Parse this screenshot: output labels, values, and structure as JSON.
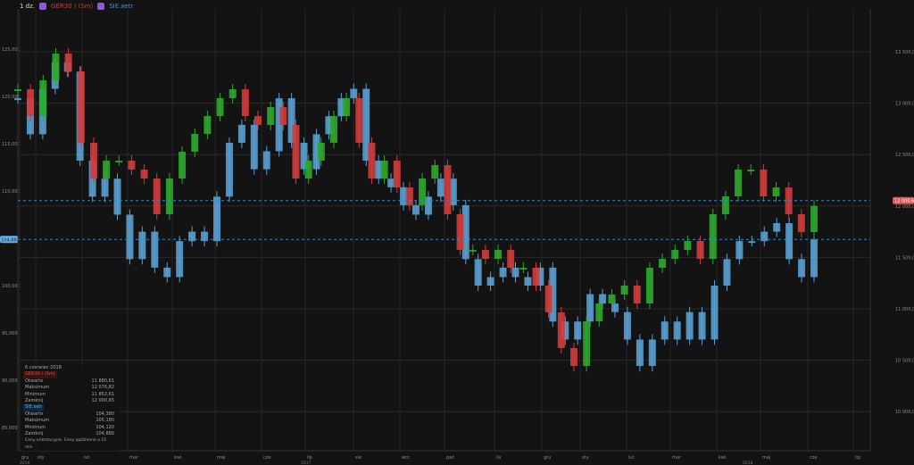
{
  "toolbar": {
    "interval": "1 dz.",
    "symbol1": "GER30 / (Sm)",
    "symbol2": "SIE.xetr",
    "icon": "instrument-icon"
  },
  "legend": {
    "date": "6 czerwiec 2018",
    "s1": {
      "name": "GER30 / (Sm)",
      "rows": [
        [
          "Otwarte",
          "11 880,61"
        ],
        [
          "Maksimum",
          "12 076,82"
        ],
        [
          "Minimum",
          "11 852,61"
        ],
        [
          "Zamknij",
          "12 000,65"
        ]
      ]
    },
    "s2": {
      "name": "SIE.xetr",
      "rows": [
        [
          "Otwarte",
          "104,380"
        ],
        [
          "Maksimum",
          "105,180"
        ],
        [
          "Minimum",
          "104,120"
        ],
        [
          "Zamknij",
          "104,880"
        ]
      ]
    },
    "note": "Ceny orientacyjne. Ceny opóźnione o 15 min"
  },
  "chart_data": {
    "type": "candlestick-overlay",
    "x_range": [
      "2016-12",
      "2018-06-06"
    ],
    "x_ticks": [
      "gru",
      "sty",
      "lut",
      "mar",
      "kwi",
      "maj",
      "cze",
      "lip",
      "sie",
      "wrz",
      "paź",
      "lis",
      "gru",
      "sty",
      "lut",
      "mar",
      "kwi",
      "maj",
      "cze",
      "lip"
    ],
    "year_labels": [
      "2016",
      "2017",
      "2018"
    ],
    "grid": true,
    "colors": {
      "up": "#2ea82e",
      "down": "#d23c3c",
      "s2": "#5aa0d0",
      "bg": "#131313"
    },
    "right_axis": {
      "series": "GER30 / (Sm)",
      "ylim": [
        9500,
        13600
      ],
      "ticks": [
        "13 500,00",
        "13 000,00",
        "12 500,00",
        "12 000,00",
        "11 500,00",
        "11 000,00",
        "10 500,00",
        "10 000,00"
      ],
      "tick_values": [
        13500,
        13000,
        12500,
        12000,
        11500,
        11000,
        10500,
        10000
      ],
      "last": "12 000,65",
      "last_value": 12000.65
    },
    "left_axis": {
      "series": "SIE.xetr",
      "ylim": [
        84,
        126
      ],
      "ticks": [
        "125,000",
        "120,000",
        "115,000",
        "110,000",
        "105,000",
        "100,000",
        "95,000",
        "90,000",
        "85,000"
      ],
      "tick_values": [
        125,
        120,
        115,
        110,
        105,
        100,
        95,
        90,
        85
      ],
      "last": "104,880",
      "last_value": 104.88
    },
    "series": [
      {
        "name": "GER30 / (Sm)",
        "axis": "right",
        "values": [
          13135,
          12875,
          13222,
          13483,
          13309,
          12615,
          12267,
          12441,
          12441,
          12354,
          12267,
          11920,
          12267,
          12528,
          12701,
          12875,
          13049,
          13135,
          12875,
          12788,
          12962,
          12788,
          12267,
          12441,
          12615,
          12875,
          13049,
          12615,
          12267,
          12441,
          12180,
          12007,
          12267,
          12398,
          11920,
          11573,
          11573,
          11486,
          11573,
          11399,
          11399,
          11226,
          10965,
          10618,
          10444,
          10878,
          11052,
          11139,
          11226,
          11052,
          11399,
          11486,
          11573,
          11660,
          11486,
          11920,
          12094,
          12354,
          12354,
          12094,
          12180,
          11920,
          11747,
          12001
        ]
      },
      {
        "name": "SIE.xetr",
        "axis": "left",
        "values": [
          119.8,
          116.0,
          120.8,
          123.6,
          122.6,
          113.2,
          109.4,
          111.3,
          107.5,
          102.8,
          105.7,
          101.9,
          100.9,
          104.7,
          105.7,
          104.7,
          109.4,
          115.1,
          117.0,
          112.3,
          114.2,
          119.8,
          115.1,
          112.3,
          116.0,
          117.9,
          119.8,
          120.8,
          113.2,
          111.3,
          110.4,
          108.5,
          107.5,
          109.4,
          111.3,
          108.5,
          102.8,
          100.0,
          100.9,
          101.9,
          100.9,
          100.0,
          101.9,
          96.2,
          94.3,
          96.2,
          99.1,
          98.1,
          97.2,
          94.3,
          91.5,
          94.3,
          96.2,
          94.3,
          97.2,
          94.3,
          100.0,
          102.8,
          104.7,
          104.7,
          105.7,
          106.6,
          102.8,
          100.9,
          104.88
        ]
      }
    ]
  }
}
